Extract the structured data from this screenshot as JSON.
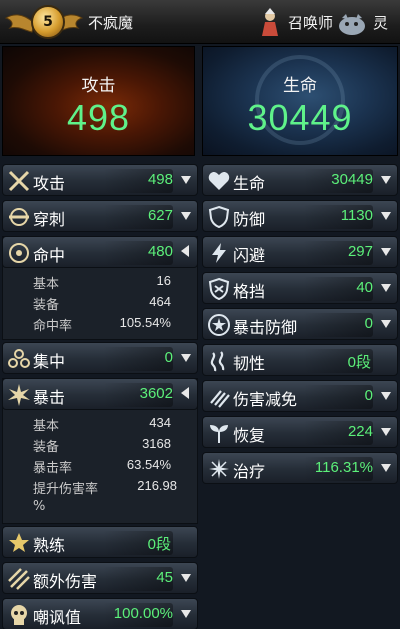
{
  "header": {
    "level": "5",
    "player_name": "不疯魔",
    "summoner_label": "召唤师",
    "spirit_label": "灵"
  },
  "hero": {
    "attack_label": "攻击",
    "attack_value": "498",
    "hp_label": "生命",
    "hp_value": "30449"
  },
  "left": {
    "attack": {
      "label": "攻击",
      "value": "498"
    },
    "pierce": {
      "label": "穿刺",
      "value": "627"
    },
    "accuracy": {
      "label": "命中",
      "value": "480",
      "details": [
        {
          "label": "基本",
          "value": "16"
        },
        {
          "label": "装备",
          "value": "464"
        },
        {
          "label": "命中率",
          "value": "105.54%"
        }
      ]
    },
    "focus": {
      "label": "集中",
      "value": "0"
    },
    "crit": {
      "label": "暴击",
      "value": "3602",
      "details": [
        {
          "label": "基本",
          "value": "434"
        },
        {
          "label": "装备",
          "value": "3168"
        },
        {
          "label": "暴击率",
          "value": "63.54%"
        },
        {
          "label": "提升伤害率",
          "value": "216.98"
        }
      ],
      "wrap": "%"
    },
    "mastery": {
      "label": "熟练",
      "value": "0段"
    },
    "extra_damage": {
      "label": "额外伤害",
      "value": "45"
    },
    "taunt": {
      "label": "嘲讽值",
      "value": "100.00%"
    }
  },
  "right": {
    "hp": {
      "label": "生命",
      "value": "30449"
    },
    "defense": {
      "label": "防御",
      "value": "1130"
    },
    "evasion": {
      "label": "闪避",
      "value": "297"
    },
    "block": {
      "label": "格挡",
      "value": "40"
    },
    "crit_defense": {
      "label": "暴击防御",
      "value": "0"
    },
    "toughness": {
      "label": "韧性",
      "value": "0段"
    },
    "damage_reduction": {
      "label": "伤害减免",
      "value": "0"
    },
    "recovery": {
      "label": "恢复",
      "value": "224"
    },
    "healing": {
      "label": "治疗",
      "value": "116.31%"
    }
  },
  "colors": {
    "value_green": "#5cf07a",
    "hero_green": "#5ff28a"
  }
}
